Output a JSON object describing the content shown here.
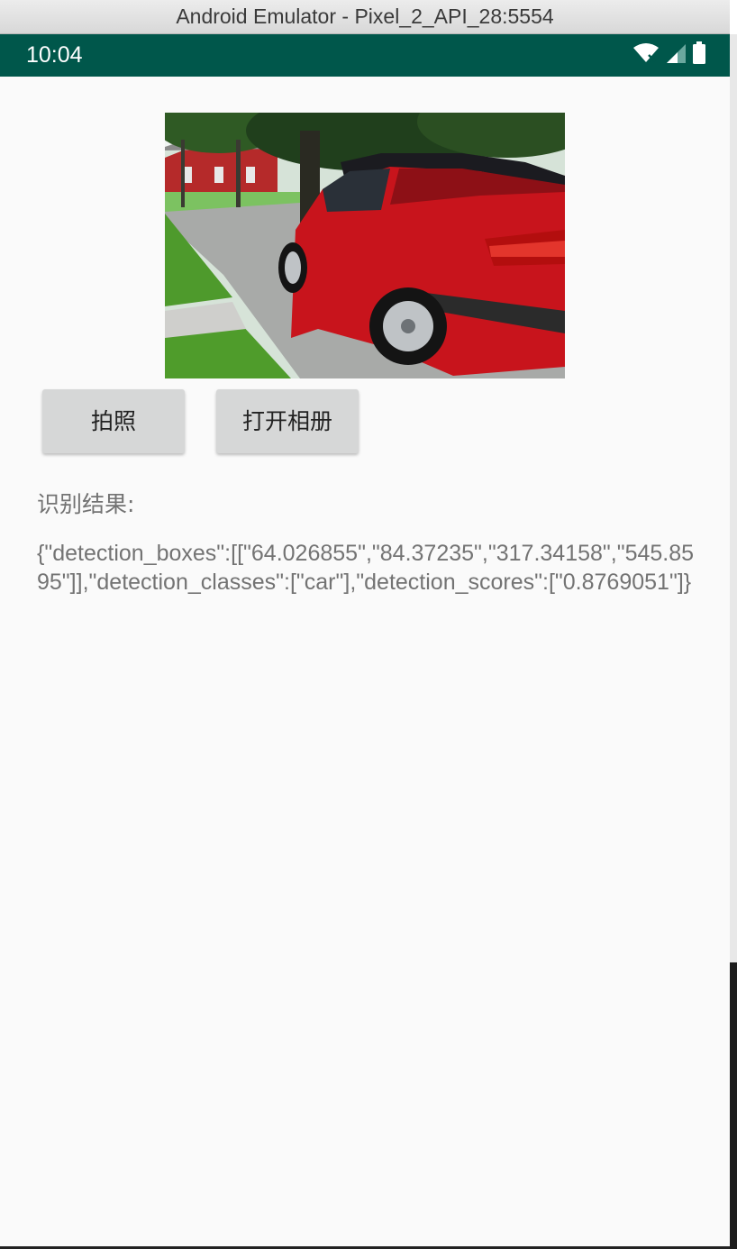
{
  "window": {
    "title": "Android Emulator - Pixel_2_API_28:5554"
  },
  "statusbar": {
    "time": "10:04",
    "icons": [
      "wifi-icon",
      "cellular-signal-icon",
      "battery-icon"
    ]
  },
  "colors": {
    "statusbar_bg": "#00574b",
    "content_bg": "#fafafa",
    "button_bg": "#d6d7d7",
    "car_red": "#c8141c"
  },
  "image": {
    "subject": "red-convertible-car-photo"
  },
  "buttons": {
    "take_photo": "拍照",
    "open_album": "打开相册"
  },
  "result": {
    "label": "识别结果:",
    "text": "{\"detection_boxes\":[[\"64.026855\",\"84.37235\",\"317.34158\",\"545.8595\"]],\"detection_classes\":[\"car\"],\"detection_scores\":[\"0.8769051\"]}"
  }
}
